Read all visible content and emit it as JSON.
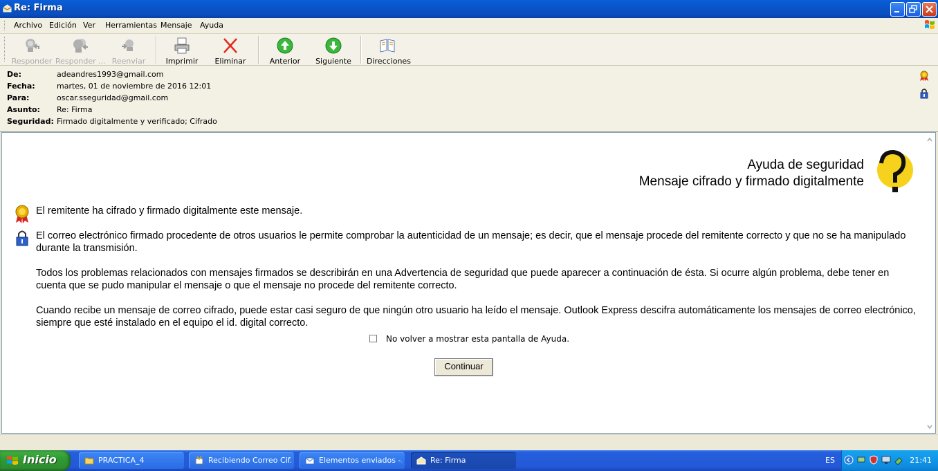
{
  "window": {
    "title": "Re: Firma"
  },
  "menu": [
    "Archivo",
    "Edición",
    "Ver",
    "Herramientas",
    "Mensaje",
    "Ayuda"
  ],
  "toolbar": {
    "reply": "Responder",
    "reply_all": "Responder ...",
    "forward": "Reenviar",
    "print": "Imprimir",
    "delete": "Eliminar",
    "previous": "Anterior",
    "next": "Siguiente",
    "addresses": "Direcciones"
  },
  "header": {
    "from_label": "De:",
    "from": "adeandres1993@gmail.com",
    "date_label": "Fecha:",
    "date": "martes, 01 de noviembre de 2016 12:01",
    "to_label": "Para:",
    "to": "oscar.sseguridad@gmail.com",
    "subject_label": "Asunto:",
    "subject": "Re: Firma",
    "security_label": "Seguridad:",
    "security": "Firmado digitalmente y verificado;  Cifrado"
  },
  "help": {
    "title_line1": "Ayuda de seguridad",
    "title_line2": "Mensaje cifrado y firmado digitalmente",
    "p1": "El remitente ha cifrado y firmado digitalmente este mensaje.",
    "p2": "El correo electrónico firmado procedente de otros usuarios le permite comprobar la autenticidad de un mensaje; es decir, que el mensaje procede del remitente correcto y que no se ha manipulado durante la transmisión.",
    "p3": "Todos los problemas relacionados con mensajes firmados se describirán en una Advertencia de seguridad que puede aparecer a continuación de ésta. Si ocurre algún problema, debe tener en cuenta que se pudo manipular el mensaje o que el mensaje no procede del remitente correcto.",
    "p4": "Cuando recibe un mensaje de correo cifrado, puede estar casi seguro de que ningún otro usuario ha leído el mensaje. Outlook Express descifra automáticamente los mensajes de correo electrónico, siempre que esté instalado en el equipo el id. digital correcto.",
    "checkbox_label": "No volver a mostrar esta pantalla de Ayuda.",
    "checkbox_checked": false,
    "continue": "Continuar"
  },
  "taskbar": {
    "start": "Inicio",
    "tasks": [
      "PRACTICA_4",
      "Recibiendo Correo Cif...",
      "Elementos enviados -...",
      "Re: Firma"
    ],
    "language": "ES",
    "clock": "21:41"
  }
}
